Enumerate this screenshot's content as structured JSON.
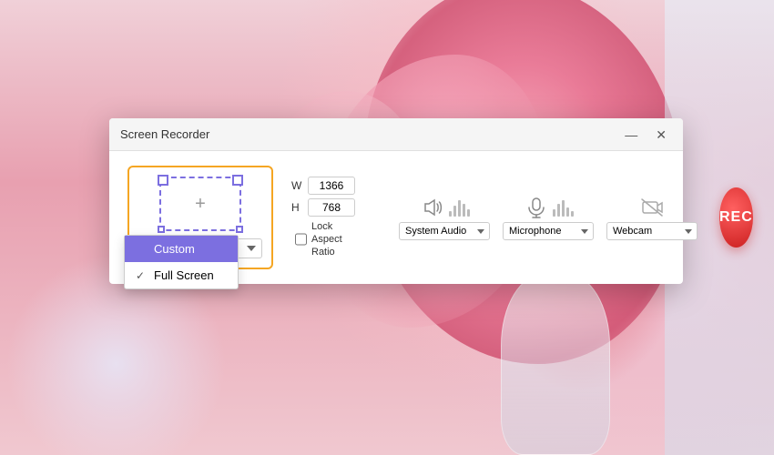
{
  "background": {
    "description": "Pink flowers on light background"
  },
  "dialog": {
    "title": "Screen Recorder",
    "controls": {
      "minimize": "—",
      "close": "✕"
    }
  },
  "screen_selector": {
    "width_label": "W",
    "height_label": "H",
    "width_value": "1366",
    "height_value": "768",
    "dropdown_selected": "Full Screen",
    "lock_label": "Lock Aspect\nRatio"
  },
  "dropdown_menu": {
    "items": [
      {
        "label": "Custom",
        "selected": false
      },
      {
        "label": "Full Screen",
        "selected": true
      }
    ]
  },
  "audio": {
    "system_label": "System Audio",
    "mic_label": "Microphone",
    "webcam_label": "Webcam",
    "system_options": [
      "System Audio"
    ],
    "mic_options": [
      "Microphone"
    ],
    "webcam_options": [
      "Webcam"
    ]
  },
  "rec_button": {
    "label": "REC"
  }
}
